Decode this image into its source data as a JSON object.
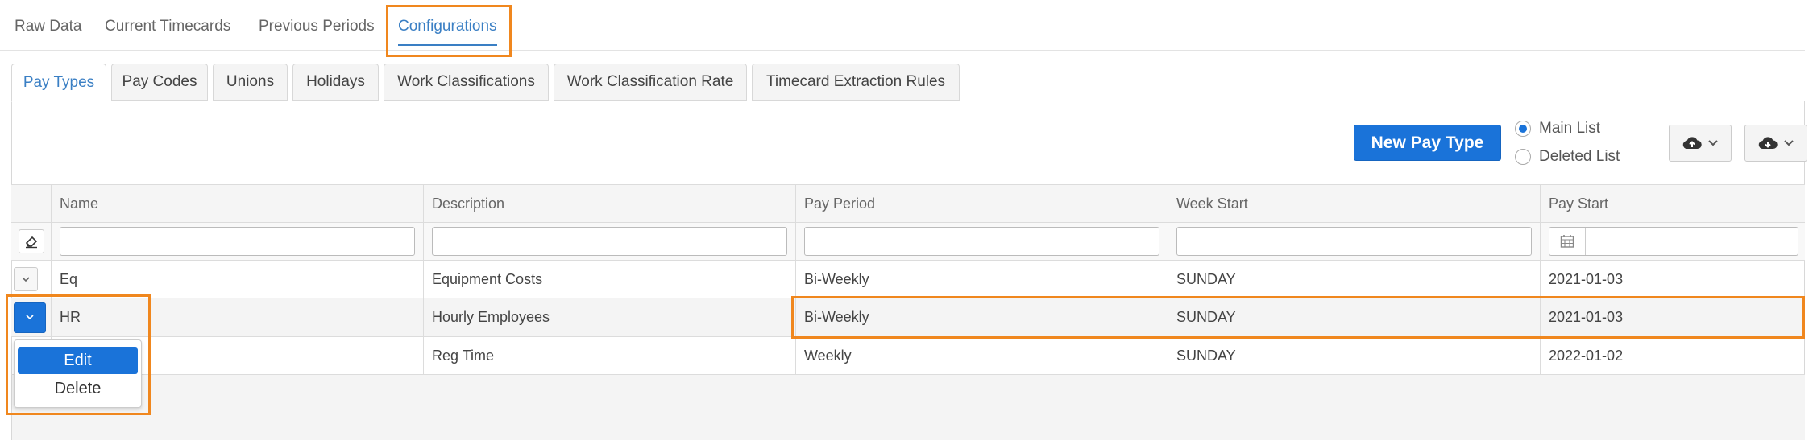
{
  "top_tabs": [
    {
      "label": "Raw Data"
    },
    {
      "label": "Current Timecards"
    },
    {
      "label": "Previous Periods"
    },
    {
      "label": "Configurations"
    }
  ],
  "sub_tabs": [
    {
      "label": "Pay Types"
    },
    {
      "label": "Pay Codes"
    },
    {
      "label": "Unions"
    },
    {
      "label": "Holidays"
    },
    {
      "label": "Work Classifications"
    },
    {
      "label": "Work Classification Rate"
    },
    {
      "label": "Timecard Extraction Rules"
    }
  ],
  "toolbar": {
    "new_button": "New Pay Type",
    "radio_main": "Main List",
    "radio_deleted": "Deleted List",
    "upload_icon": "cloud-upload-icon",
    "download_icon": "cloud-download-icon"
  },
  "grid": {
    "columns": [
      "Name",
      "Description",
      "Pay Period",
      "Week Start",
      "Pay Start"
    ],
    "rows": [
      {
        "name": "Eq",
        "description": "Equipment Costs",
        "pay_period": "Bi-Weekly",
        "week_start": "SUNDAY",
        "pay_start": "2021-01-03"
      },
      {
        "name": "HR",
        "description": "Hourly Employees",
        "pay_period": "Bi-Weekly",
        "week_start": "SUNDAY",
        "pay_start": "2021-01-03"
      },
      {
        "name": "",
        "description": "Reg Time",
        "pay_period": "Weekly",
        "week_start": "SUNDAY",
        "pay_start": "2022-01-02"
      }
    ]
  },
  "row_menu": {
    "edit": "Edit",
    "delete": "Delete"
  },
  "colors": {
    "accent": "#1a73d9",
    "link": "#3a7fc4",
    "highlight": "#f0871e"
  }
}
